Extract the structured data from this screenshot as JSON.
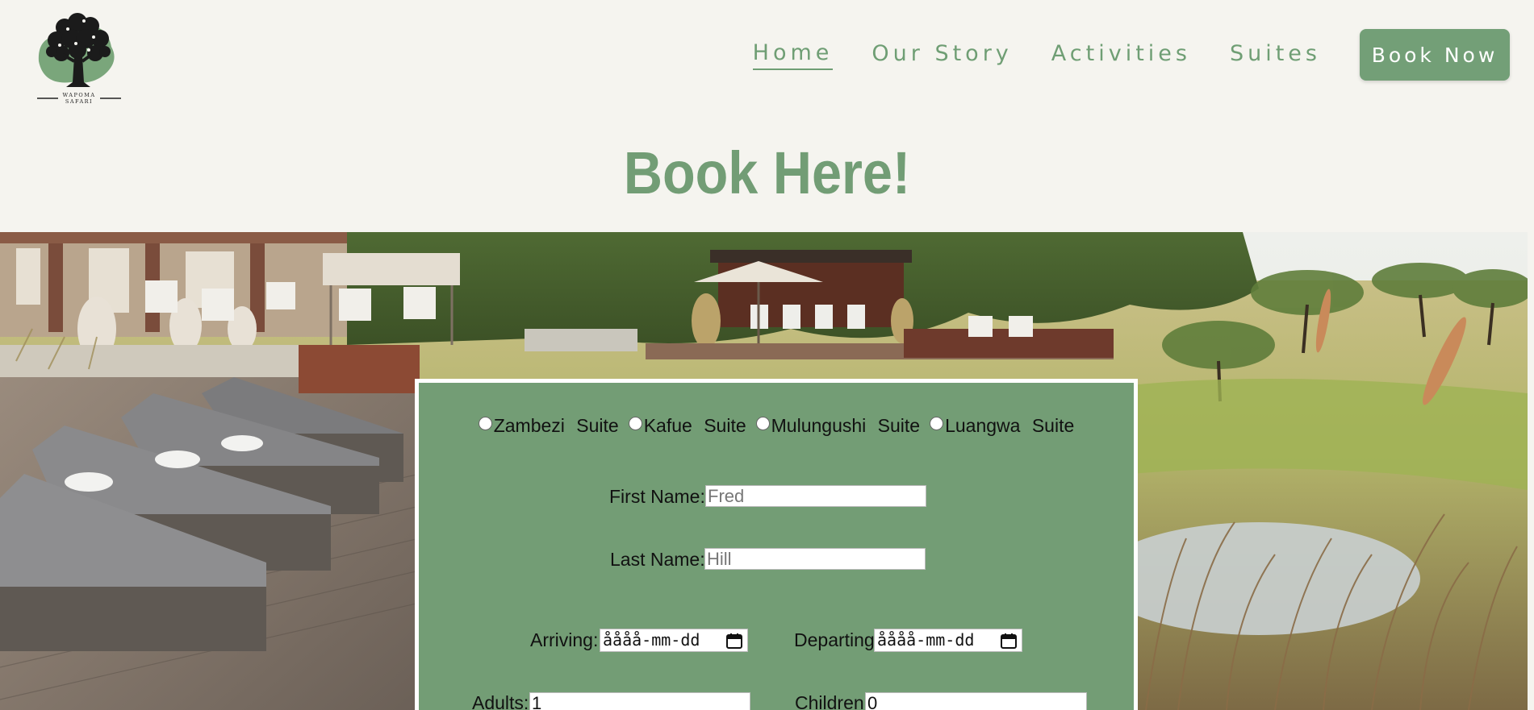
{
  "brand": {
    "logo_line1": "WAPOMA",
    "logo_line2": "SAFARI"
  },
  "nav": {
    "items": [
      {
        "label": "Home",
        "active": true
      },
      {
        "label": "Our Story",
        "active": false
      },
      {
        "label": "Activities",
        "active": false
      },
      {
        "label": "Suites",
        "active": false
      }
    ],
    "cta_label": "Book Now"
  },
  "page": {
    "title": "Book Here!"
  },
  "form": {
    "suites": [
      "Zambezi Suite",
      "Kafue Suite",
      "Mulungushi Suite",
      "Luangwa Suite"
    ],
    "first_name_label": "First Name:",
    "first_name_placeholder": "Fred",
    "last_name_label": "Last Name:",
    "last_name_placeholder": "Hill",
    "arriving_label": "Arriving:",
    "arriving_value": "åååå-mm-dd",
    "departing_label": "Departing:",
    "departing_value": "åååå-mm-dd",
    "adults_label": "Adults:",
    "adults_value": "1",
    "children_label": "Children:",
    "children_value": "0"
  },
  "colors": {
    "accent": "#739f77",
    "background": "#f5f4ef",
    "form_bg": "#739d75"
  }
}
